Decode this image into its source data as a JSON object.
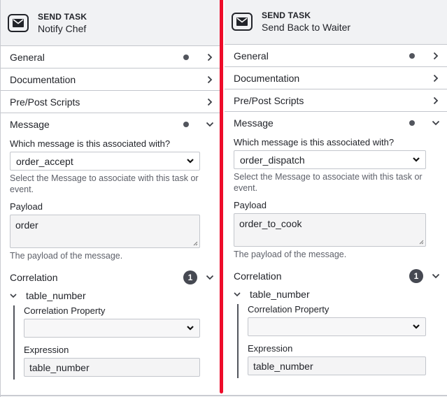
{
  "panels": [
    {
      "header": {
        "kind": "SEND TASK",
        "name": "Notify Chef",
        "icon": "envelope-icon"
      },
      "groups": [
        {
          "label": "General",
          "has_dot": true,
          "expanded": false
        },
        {
          "label": "Documentation",
          "has_dot": false,
          "expanded": false
        },
        {
          "label": "Pre/Post Scripts",
          "has_dot": false,
          "expanded": false
        },
        {
          "label": "Message",
          "has_dot": true,
          "expanded": true
        }
      ],
      "message": {
        "select_label": "Which message is this associated with?",
        "select_value": "order_accept",
        "select_description": "Select the Message to associate with this task or event.",
        "payload_label": "Payload",
        "payload_value": "order",
        "payload_description": "The payload of the message."
      },
      "correlation": {
        "label": "Correlation",
        "count": "1",
        "items": [
          {
            "name": "table_number",
            "property_label": "Correlation Property",
            "property_value": "",
            "expression_label": "Expression",
            "expression_value": "table_number"
          }
        ]
      }
    },
    {
      "header": {
        "kind": "SEND TASK",
        "name": "Send Back to Waiter",
        "icon": "envelope-icon"
      },
      "groups": [
        {
          "label": "General",
          "has_dot": true,
          "expanded": false
        },
        {
          "label": "Documentation",
          "has_dot": false,
          "expanded": false
        },
        {
          "label": "Pre/Post Scripts",
          "has_dot": false,
          "expanded": false
        },
        {
          "label": "Message",
          "has_dot": true,
          "expanded": true
        }
      ],
      "message": {
        "select_label": "Which message is this associated with?",
        "select_value": "order_dispatch",
        "select_description": "Select the Message to associate with this task or event.",
        "payload_label": "Payload",
        "payload_value": "order_to_cook",
        "payload_description": "The payload of the message."
      },
      "correlation": {
        "label": "Correlation",
        "count": "1",
        "items": [
          {
            "name": "table_number",
            "property_label": "Correlation Property",
            "property_value": "",
            "expression_label": "Expression",
            "expression_value": "table_number"
          }
        ]
      }
    }
  ],
  "colors": {
    "divider": "#ee0c2a",
    "header_bg": "#f1f2f4",
    "badge_bg": "#464952"
  }
}
